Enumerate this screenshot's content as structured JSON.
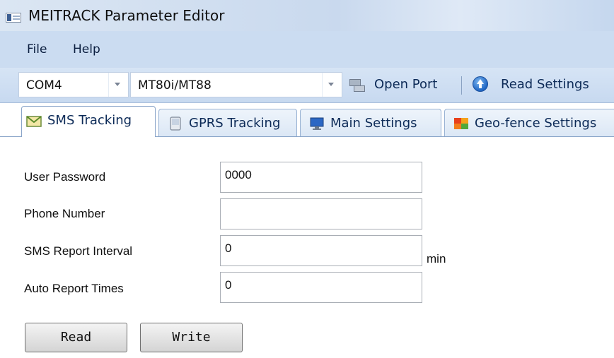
{
  "window": {
    "title": "MEITRACK Parameter Editor"
  },
  "menu": {
    "items": [
      "File",
      "Help"
    ]
  },
  "toolbar": {
    "port_value": "COM4",
    "model_value": "MT80i/MT88",
    "open_port_label": "Open Port",
    "read_settings_label": "Read Settings"
  },
  "tabs": [
    {
      "label": "SMS Tracking",
      "active": true
    },
    {
      "label": "GPRS Tracking",
      "active": false
    },
    {
      "label": "Main Settings",
      "active": false
    },
    {
      "label": "Geo-fence Settings",
      "active": false
    }
  ],
  "form": {
    "user_password": {
      "label": "User Password",
      "value": "0000"
    },
    "phone_number": {
      "label": "Phone Number",
      "value": ""
    },
    "sms_report_interval": {
      "label": "SMS Report Interval",
      "value": "0",
      "unit": "min"
    },
    "auto_report_times": {
      "label": "Auto Report Times",
      "value": "0"
    }
  },
  "buttons": {
    "read_label": "Read",
    "write_label": "Write"
  },
  "colors": {
    "title_bar": "#c9d9ee",
    "menu_bar": "#cbdcf1",
    "tab_border": "#8aa5c9"
  }
}
